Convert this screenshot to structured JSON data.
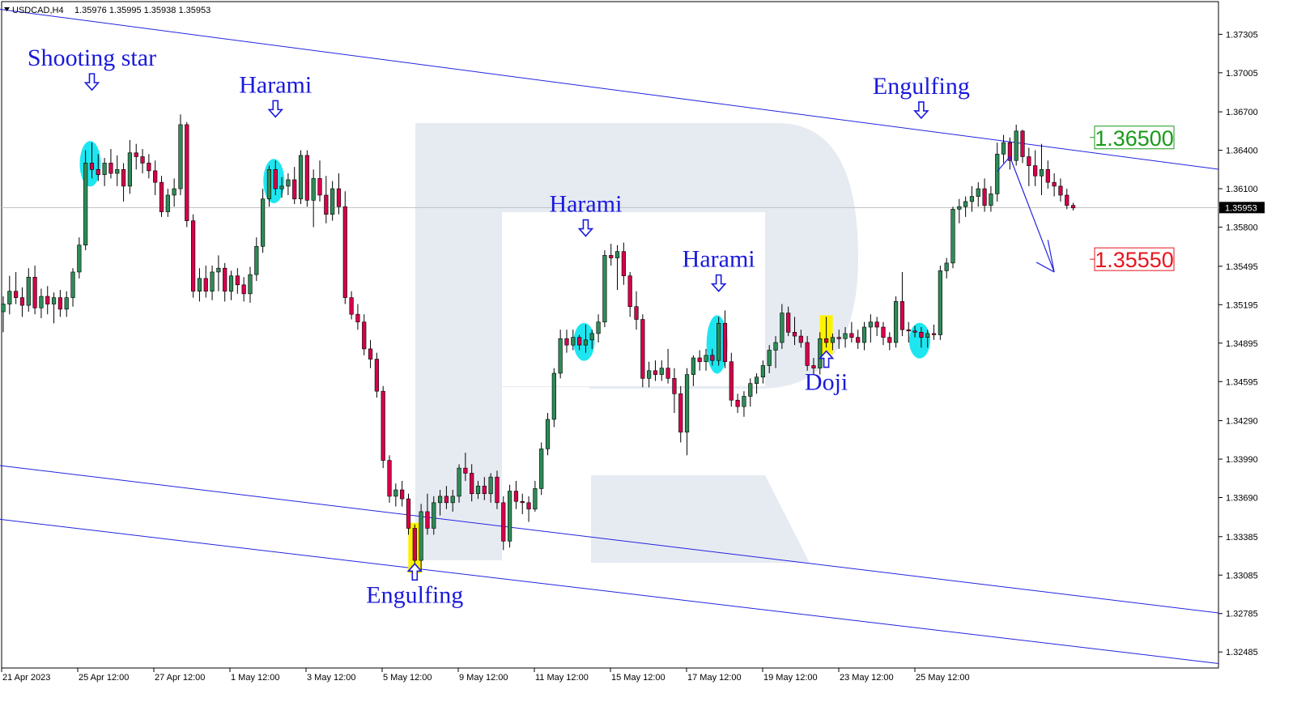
{
  "header": {
    "symbol": "USDCAD,H4",
    "ohlc": "1.35976 1.35995 1.35938 1.35953"
  },
  "colors": {
    "bull": "#2e8b57",
    "bear": "#d6004a",
    "channel": "#2323e0",
    "annotation": "#1a1adb",
    "highlight_circle": "#1ee6f0",
    "highlight_doji": "#fff200",
    "target_up": "#1a9a1a",
    "target_down": "#e8141e",
    "watermark": "#e6ebf2"
  },
  "chart_data": {
    "type": "candlestick",
    "symbol": "USDCAD",
    "timeframe": "H4",
    "ylim": [
      1.3236,
      1.3756
    ],
    "y_ticks": [
      "1.37305",
      "1.37005",
      "1.36700",
      "1.36400",
      "1.36100",
      "1.35800",
      "1.35495",
      "1.35195",
      "1.34895",
      "1.34595",
      "1.34290",
      "1.33990",
      "1.33690",
      "1.33385",
      "1.33085",
      "1.32785",
      "1.32485"
    ],
    "x_ticks": [
      "21 Apr 2023",
      "25 Apr 12:00",
      "27 Apr 12:00",
      "1 May 12:00",
      "3 May 12:00",
      "5 May 12:00",
      "9 May 12:00",
      "11 May 12:00",
      "15 May 12:00",
      "17 May 12:00",
      "19 May 12:00",
      "23 May 12:00",
      "25 May 12:00"
    ],
    "current_price": "1.35953",
    "candles": [
      [
        1.3514,
        1.3526,
        1.3498,
        1.352
      ],
      [
        1.352,
        1.3542,
        1.3512,
        1.353
      ],
      [
        1.353,
        1.3545,
        1.352,
        1.3525
      ],
      [
        1.3525,
        1.3533,
        1.351,
        1.3519
      ],
      [
        1.3519,
        1.3548,
        1.3514,
        1.3541
      ],
      [
        1.3541,
        1.355,
        1.3512,
        1.3517
      ],
      [
        1.3517,
        1.3532,
        1.3509,
        1.3526
      ],
      [
        1.3526,
        1.3534,
        1.3512,
        1.352
      ],
      [
        1.352,
        1.3529,
        1.3505,
        1.3525
      ],
      [
        1.3525,
        1.3531,
        1.351,
        1.3516
      ],
      [
        1.3516,
        1.353,
        1.351,
        1.3525
      ],
      [
        1.3525,
        1.3548,
        1.3518,
        1.3545
      ],
      [
        1.3545,
        1.3572,
        1.354,
        1.3566
      ],
      [
        1.3566,
        1.364,
        1.3562,
        1.363
      ],
      [
        1.363,
        1.3646,
        1.3618,
        1.3625
      ],
      [
        1.3625,
        1.3637,
        1.3616,
        1.3621
      ],
      [
        1.3621,
        1.3634,
        1.3612,
        1.363
      ],
      [
        1.363,
        1.3641,
        1.3618,
        1.3622
      ],
      [
        1.3622,
        1.3636,
        1.3612,
        1.3625
      ],
      [
        1.3625,
        1.363,
        1.36,
        1.3612
      ],
      [
        1.3612,
        1.3648,
        1.3606,
        1.3638
      ],
      [
        1.3638,
        1.3645,
        1.3625,
        1.3635
      ],
      [
        1.3635,
        1.3641,
        1.3622,
        1.363
      ],
      [
        1.363,
        1.3637,
        1.3618,
        1.3624
      ],
      [
        1.3624,
        1.3632,
        1.3605,
        1.3615
      ],
      [
        1.3615,
        1.362,
        1.3588,
        1.3592
      ],
      [
        1.3592,
        1.361,
        1.3588,
        1.3605
      ],
      [
        1.3605,
        1.3618,
        1.3596,
        1.361
      ],
      [
        1.361,
        1.3668,
        1.3605,
        1.366
      ],
      [
        1.366,
        1.3662,
        1.358,
        1.3585
      ],
      [
        1.3585,
        1.359,
        1.3525,
        1.353
      ],
      [
        1.353,
        1.3548,
        1.3522,
        1.354
      ],
      [
        1.354,
        1.355,
        1.3525,
        1.353
      ],
      [
        1.353,
        1.355,
        1.3523,
        1.3545
      ],
      [
        1.3545,
        1.3558,
        1.353,
        1.3548
      ],
      [
        1.3548,
        1.3552,
        1.3522,
        1.353
      ],
      [
        1.353,
        1.3546,
        1.3523,
        1.3542
      ],
      [
        1.3542,
        1.3548,
        1.3528,
        1.3535
      ],
      [
        1.3535,
        1.3541,
        1.3522,
        1.3528
      ],
      [
        1.3528,
        1.3549,
        1.3521,
        1.3543
      ],
      [
        1.3543,
        1.3572,
        1.3538,
        1.3565
      ],
      [
        1.3565,
        1.361,
        1.356,
        1.3602
      ],
      [
        1.3602,
        1.3628,
        1.3596,
        1.3625
      ],
      [
        1.3625,
        1.3632,
        1.3605,
        1.361
      ],
      [
        1.361,
        1.3619,
        1.3603,
        1.3612
      ],
      [
        1.3612,
        1.3622,
        1.3605,
        1.3617
      ],
      [
        1.3617,
        1.3627,
        1.3598,
        1.3602
      ],
      [
        1.3602,
        1.364,
        1.3598,
        1.3636
      ],
      [
        1.3636,
        1.364,
        1.3596,
        1.3601
      ],
      [
        1.3601,
        1.3625,
        1.358,
        1.3618
      ],
      [
        1.3618,
        1.3632,
        1.36,
        1.3605
      ],
      [
        1.3605,
        1.362,
        1.3583,
        1.359
      ],
      [
        1.359,
        1.3616,
        1.3585,
        1.361
      ],
      [
        1.361,
        1.3622,
        1.359,
        1.3596
      ],
      [
        1.3596,
        1.3608,
        1.352,
        1.3525
      ],
      [
        1.3525,
        1.353,
        1.3508,
        1.3512
      ],
      [
        1.3512,
        1.352,
        1.35,
        1.3506
      ],
      [
        1.3506,
        1.3512,
        1.348,
        1.3485
      ],
      [
        1.3485,
        1.3492,
        1.347,
        1.3477
      ],
      [
        1.3477,
        1.3482,
        1.3447,
        1.3452
      ],
      [
        1.3452,
        1.3456,
        1.3392,
        1.3398
      ],
      [
        1.3398,
        1.3402,
        1.3365,
        1.337
      ],
      [
        1.337,
        1.338,
        1.3362,
        1.3375
      ],
      [
        1.3375,
        1.3382,
        1.3362,
        1.3368
      ],
      [
        1.3368,
        1.3372,
        1.334,
        1.3345
      ],
      [
        1.3345,
        1.3348,
        1.3315,
        1.332
      ],
      [
        1.332,
        1.3364,
        1.3312,
        1.3358
      ],
      [
        1.3358,
        1.3372,
        1.334,
        1.3345
      ],
      [
        1.3345,
        1.337,
        1.334,
        1.3365
      ],
      [
        1.3365,
        1.3375,
        1.3355,
        1.337
      ],
      [
        1.337,
        1.3378,
        1.336,
        1.3365
      ],
      [
        1.3365,
        1.3375,
        1.3358,
        1.337
      ],
      [
        1.337,
        1.3395,
        1.3365,
        1.3392
      ],
      [
        1.3392,
        1.3404,
        1.3382,
        1.3388
      ],
      [
        1.3388,
        1.3395,
        1.3366,
        1.3372
      ],
      [
        1.3372,
        1.3382,
        1.3368,
        1.3378
      ],
      [
        1.3378,
        1.3385,
        1.3367,
        1.3372
      ],
      [
        1.3372,
        1.3388,
        1.3365,
        1.3385
      ],
      [
        1.3385,
        1.339,
        1.336,
        1.3365
      ],
      [
        1.3365,
        1.337,
        1.3328,
        1.3335
      ],
      [
        1.3335,
        1.3379,
        1.333,
        1.3374
      ],
      [
        1.3374,
        1.3382,
        1.336,
        1.3366
      ],
      [
        1.3366,
        1.3372,
        1.3356,
        1.3365
      ],
      [
        1.3365,
        1.337,
        1.335,
        1.336
      ],
      [
        1.336,
        1.3382,
        1.3358,
        1.3376
      ],
      [
        1.3376,
        1.3412,
        1.3371,
        1.3407
      ],
      [
        1.3407,
        1.3435,
        1.3402,
        1.343
      ],
      [
        1.343,
        1.347,
        1.3424,
        1.3466
      ],
      [
        1.3466,
        1.35,
        1.3462,
        1.3493
      ],
      [
        1.3493,
        1.35,
        1.3482,
        1.3488
      ],
      [
        1.3488,
        1.35,
        1.3484,
        1.3494
      ],
      [
        1.3494,
        1.3496,
        1.3484,
        1.3488
      ],
      [
        1.3488,
        1.3504,
        1.3482,
        1.3492
      ],
      [
        1.3492,
        1.35,
        1.3485,
        1.3497
      ],
      [
        1.3497,
        1.3512,
        1.349,
        1.3506
      ],
      [
        1.3506,
        1.3562,
        1.3502,
        1.3558
      ],
      [
        1.3558,
        1.3567,
        1.355,
        1.3556
      ],
      [
        1.3556,
        1.3566,
        1.3531,
        1.3561
      ],
      [
        1.3561,
        1.3568,
        1.3535,
        1.3542
      ],
      [
        1.3542,
        1.3545,
        1.351,
        1.3518
      ],
      [
        1.3518,
        1.353,
        1.35,
        1.3508
      ],
      [
        1.3508,
        1.3512,
        1.3455,
        1.3462
      ],
      [
        1.3462,
        1.3475,
        1.3455,
        1.3468
      ],
      [
        1.3468,
        1.3476,
        1.346,
        1.3465
      ],
      [
        1.3465,
        1.3476,
        1.346,
        1.347
      ],
      [
        1.347,
        1.3485,
        1.3458,
        1.3462
      ],
      [
        1.3462,
        1.347,
        1.3435,
        1.345
      ],
      [
        1.345,
        1.3456,
        1.3412,
        1.342
      ],
      [
        1.342,
        1.347,
        1.3402,
        1.3465
      ],
      [
        1.3465,
        1.348,
        1.3456,
        1.3478
      ],
      [
        1.3478,
        1.3484,
        1.3468,
        1.3475
      ],
      [
        1.3475,
        1.3485,
        1.3468,
        1.348
      ],
      [
        1.348,
        1.3485,
        1.3472,
        1.3476
      ],
      [
        1.3476,
        1.351,
        1.3472,
        1.3505
      ],
      [
        1.3505,
        1.3515,
        1.347,
        1.3475
      ],
      [
        1.3475,
        1.3482,
        1.344,
        1.3445
      ],
      [
        1.3445,
        1.345,
        1.3435,
        1.344
      ],
      [
        1.344,
        1.3452,
        1.3432,
        1.3448
      ],
      [
        1.3448,
        1.3462,
        1.344,
        1.3458
      ],
      [
        1.3458,
        1.3466,
        1.345,
        1.3463
      ],
      [
        1.3463,
        1.3476,
        1.3458,
        1.3472
      ],
      [
        1.3472,
        1.3488,
        1.3466,
        1.3484
      ],
      [
        1.3484,
        1.3495,
        1.347,
        1.349
      ],
      [
        1.349,
        1.352,
        1.3485,
        1.3513
      ],
      [
        1.3513,
        1.3518,
        1.3495,
        1.3498
      ],
      [
        1.3498,
        1.351,
        1.3488,
        1.3495
      ],
      [
        1.3495,
        1.35,
        1.3486,
        1.349
      ],
      [
        1.349,
        1.3495,
        1.3468,
        1.3472
      ],
      [
        1.3472,
        1.3478,
        1.3465,
        1.347
      ],
      [
        1.347,
        1.3498,
        1.3465,
        1.3493
      ],
      [
        1.3493,
        1.351,
        1.3486,
        1.349
      ],
      [
        1.349,
        1.3497,
        1.3484,
        1.3494
      ],
      [
        1.3494,
        1.35,
        1.3485,
        1.3493
      ],
      [
        1.3493,
        1.3502,
        1.3486,
        1.3497
      ],
      [
        1.3497,
        1.3506,
        1.349,
        1.3494
      ],
      [
        1.3494,
        1.35,
        1.3485,
        1.349
      ],
      [
        1.349,
        1.3506,
        1.3484,
        1.3502
      ],
      [
        1.3502,
        1.3512,
        1.349,
        1.3506
      ],
      [
        1.3506,
        1.351,
        1.3495,
        1.3502
      ],
      [
        1.3502,
        1.3506,
        1.3488,
        1.3494
      ],
      [
        1.3494,
        1.3498,
        1.3484,
        1.349
      ],
      [
        1.349,
        1.3526,
        1.3486,
        1.3522
      ],
      [
        1.3522,
        1.3545,
        1.3495,
        1.35
      ],
      [
        1.35,
        1.3506,
        1.349,
        1.3499
      ],
      [
        1.3499,
        1.3503,
        1.3494,
        1.3498
      ],
      [
        1.3498,
        1.3502,
        1.3486,
        1.3494
      ],
      [
        1.3494,
        1.35,
        1.3486,
        1.3497
      ],
      [
        1.3497,
        1.3504,
        1.3492,
        1.3496
      ],
      [
        1.3496,
        1.355,
        1.3492,
        1.3546
      ],
      [
        1.3546,
        1.3556,
        1.354,
        1.3552
      ],
      [
        1.3552,
        1.3596,
        1.3548,
        1.3594
      ],
      [
        1.3594,
        1.3602,
        1.3583,
        1.3596
      ],
      [
        1.3596,
        1.3604,
        1.3588,
        1.36
      ],
      [
        1.36,
        1.3612,
        1.3592,
        1.3604
      ],
      [
        1.3604,
        1.3615,
        1.3596,
        1.361
      ],
      [
        1.361,
        1.3618,
        1.3592,
        1.3597
      ],
      [
        1.3597,
        1.3612,
        1.3592,
        1.3606
      ],
      [
        1.3606,
        1.3646,
        1.36,
        1.3637
      ],
      [
        1.3637,
        1.3652,
        1.363,
        1.3646
      ],
      [
        1.3646,
        1.365,
        1.3625,
        1.3632
      ],
      [
        1.3632,
        1.366,
        1.3628,
        1.3655
      ],
      [
        1.3655,
        1.3656,
        1.363,
        1.3635
      ],
      [
        1.3635,
        1.3642,
        1.3612,
        1.3628
      ],
      [
        1.3628,
        1.364,
        1.3612,
        1.362
      ],
      [
        1.362,
        1.3645,
        1.3605,
        1.3625
      ],
      [
        1.3625,
        1.3632,
        1.361,
        1.3615
      ],
      [
        1.3615,
        1.3622,
        1.3604,
        1.3612
      ],
      [
        1.3612,
        1.3618,
        1.36,
        1.3605
      ],
      [
        1.3605,
        1.361,
        1.3594,
        1.3597
      ],
      [
        1.3597,
        1.3599,
        1.3593,
        1.3595
      ]
    ],
    "channel_lines": [
      {
        "name": "upper",
        "from": [
          0,
          1.375
        ],
        "to": [
          188,
          1.36252
        ]
      },
      {
        "name": "lower-1",
        "from": [
          0,
          1.3394
        ],
        "to": [
          188,
          1.3279
        ]
      },
      {
        "name": "lower-2",
        "from": [
          0,
          1.3352
        ],
        "to": [
          188,
          1.32395
        ]
      }
    ],
    "forecast_path": [
      [
        157,
        1.36235
      ],
      [
        159,
        1.3635
      ],
      [
        166,
        1.3545
      ]
    ],
    "forecast_arrow_tail": [
      [
        165,
        1.357
      ],
      [
        166,
        1.3545
      ]
    ],
    "levels": [
      {
        "label": "1.36500",
        "price": 1.365,
        "kind": "target-up"
      },
      {
        "label": "1.35550",
        "price": 1.3555,
        "kind": "target-down"
      }
    ],
    "annotations": [
      {
        "text": "Shooting star",
        "candle": 14,
        "kind": "circle",
        "text_price": 1.3706,
        "arrow": "down"
      },
      {
        "text": "Harami",
        "candle": 43,
        "kind": "circle",
        "text_price": 1.3685,
        "arrow": "down"
      },
      {
        "text": "Harami",
        "candle": 92,
        "kind": "circle",
        "text_price": 1.3592,
        "arrow": "down"
      },
      {
        "text": "Harami",
        "candle": 113,
        "kind": "circle",
        "text_price": 1.3549,
        "arrow": "down"
      },
      {
        "text": "Engulfing",
        "candle": 145,
        "kind": "circle",
        "text_price": 1.3684,
        "arrow": "down"
      },
      {
        "text": "Engulfing",
        "candle": 65,
        "kind": "rect",
        "text_price": 1.3287,
        "arrow": "up"
      },
      {
        "text": "Doji",
        "candle": 130,
        "kind": "rect",
        "text_price": 1.3453,
        "arrow": "up"
      }
    ]
  }
}
